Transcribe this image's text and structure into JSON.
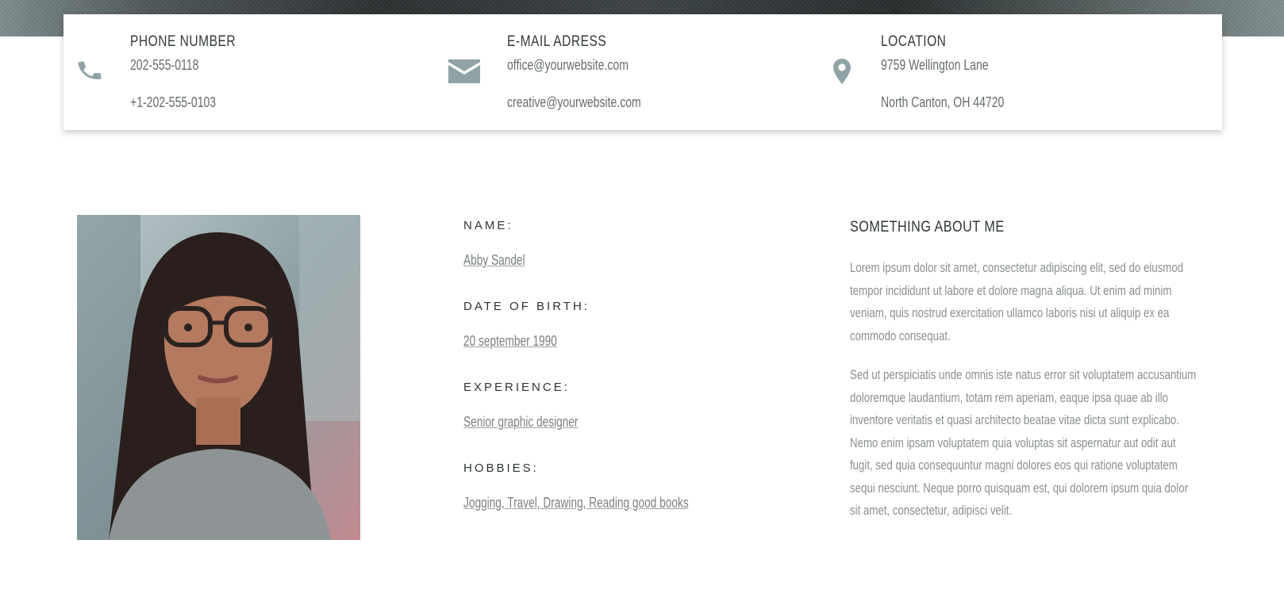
{
  "contact": {
    "phone": {
      "icon": "phone-icon",
      "title": "PHONE NUMBER",
      "line1": "202-555-0118",
      "line2": "+1-202-555-0103"
    },
    "email": {
      "icon": "envelope-icon",
      "title": "E-MAIL ADRESS",
      "line1": "office@yourwebsite.com",
      "line2": "creative@yourwebsite.com"
    },
    "location": {
      "icon": "map-pin-icon",
      "title": "LOCATION",
      "line1": "9759 Wellington Lane",
      "line2": "North Canton, OH 44720"
    },
    "icon_color": "#8fa3a6"
  },
  "profile": {
    "name_label": "NAME:",
    "name_value": "Abby Sandel",
    "dob_label": "DATE OF BIRTH:",
    "dob_value": "20 september 1990",
    "experience_label": "EXPERIENCE:",
    "experience_value": "Senior graphic designer",
    "hobbies_label": "HOBBIES:",
    "hobbies_value": "Jogging, Travel, Drawing, Reading good books"
  },
  "about": {
    "title": "SOMETHING ABOUT ME",
    "paragraph1": "Lorem ipsum dolor sit amet, consectetur adipiscing elit, sed do eiusmod tempor incididunt ut labore et dolore magna aliqua. Ut enim ad minim veniam, quis nostrud exercitation ullamco laboris nisi ut aliquip ex ea commodo consequat.",
    "paragraph2": "Sed ut perspiciatis unde omnis iste natus error sit voluptatem accusantium doloremque laudantium, totam rem aperiam, eaque ipsa quae ab illo inventore veritatis et quasi architecto beatae vitae dicta sunt explicabo. Nemo enim ipsam voluptatem quia voluptas sit aspernatur aut odit aut fugit, sed quia consequuntur magni dolores eos qui ratione voluptatem sequi nesciunt. Neque porro quisquam est, qui dolorem ipsum quia dolor sit amet, consectetur, adipisci velit."
  }
}
